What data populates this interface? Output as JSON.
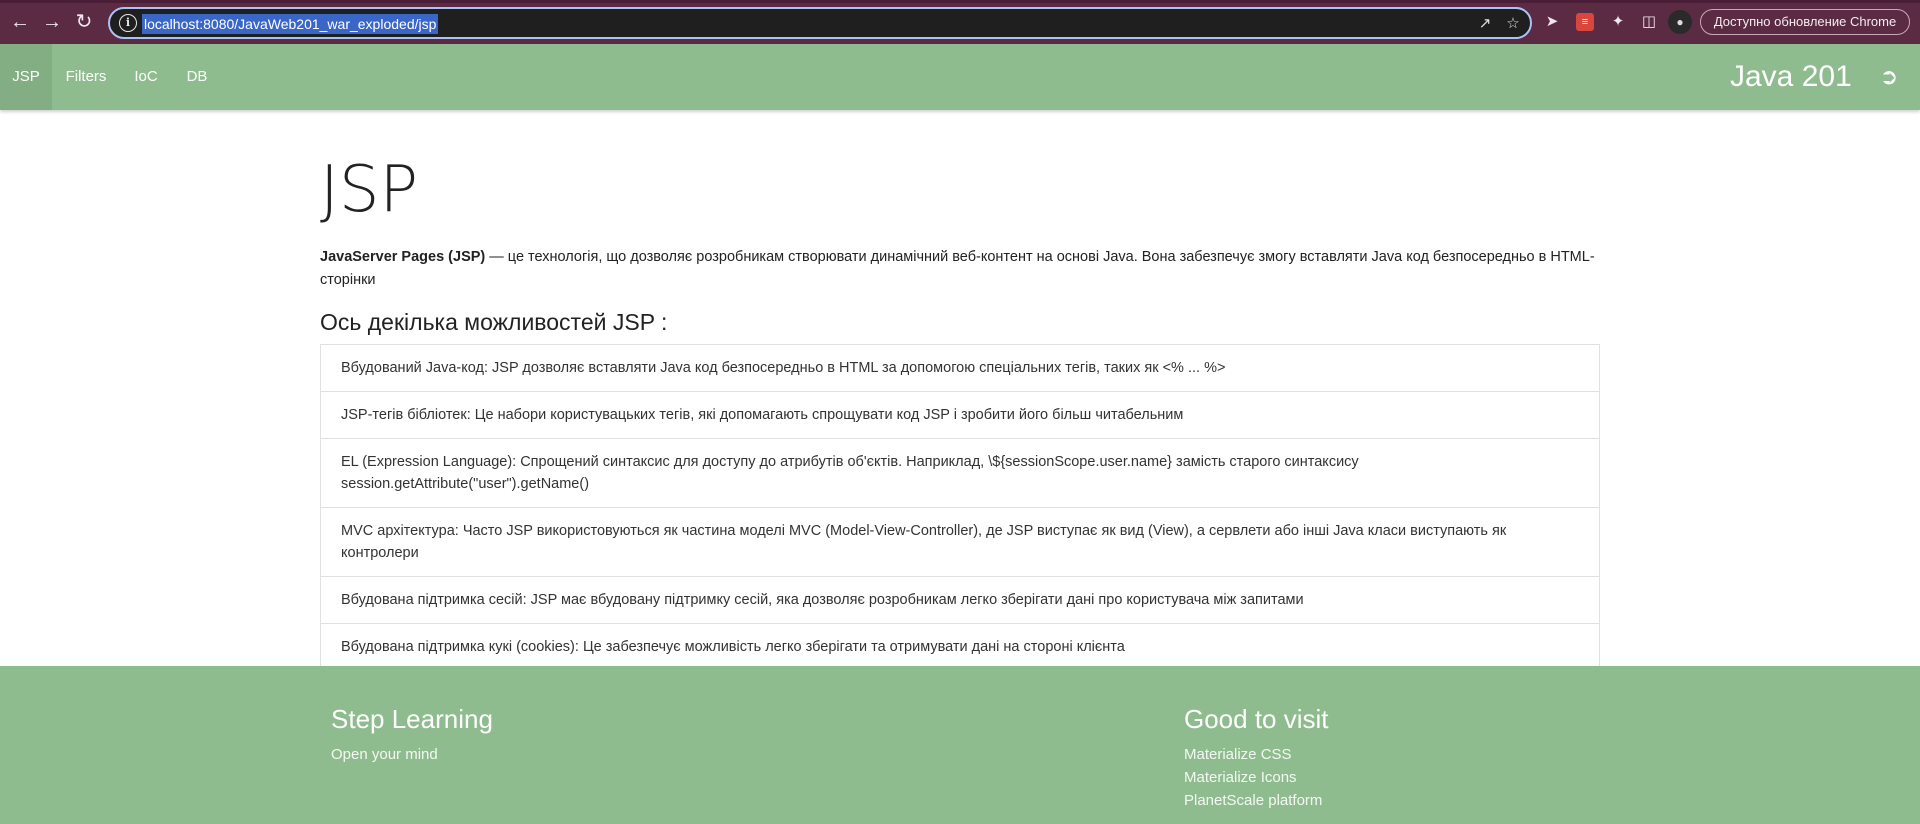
{
  "browser": {
    "url": "localhost:8080/JavaWeb201_war_exploded/jsp",
    "update_label": "Доступно обновление Chrome"
  },
  "nav": {
    "tabs": [
      {
        "label": "JSP",
        "active": true
      },
      {
        "label": "Filters",
        "active": false
      },
      {
        "label": "IoC",
        "active": false
      },
      {
        "label": "DB",
        "active": false
      }
    ],
    "brand": "Java 201"
  },
  "main": {
    "title": "JSP",
    "intro_bold": "JavaServer Pages (JSP)",
    "intro_rest": " — це технологія, що дозволяє розробникам створювати динамічний веб-контент на основі Java. Вона забезпечує змогу вставляти Java код безпосередньо в HTML-сторінки",
    "section_title": "Ось декілька можливостей JSP :",
    "features": [
      "Вбудований Java-код: JSP дозволяє вставляти Java код безпосередньо в HTML за допомогою спеціальних тегів, таких як <% ... %>",
      "JSP-тегів бібліотек: Це набори користувацьких тегів, які допомагають спрощувати код JSP і зробити його більш читабельним",
      "EL (Expression Language): Спрощений синтаксис для доступу до атрибутів об'єктів. Наприклад, \\${sessionScope.user.name} замість старого синтаксису session.getAttribute(\"user\").getName()",
      "MVC архітектура: Часто JSP використовуються як частина моделі MVC (Model-View-Controller), де JSP виступає як вид (View), а сервлети або інші Java класи виступають як контролери",
      "Вбудована підтримка сесій: JSP має вбудовану підтримку сесій, яка дозволяє розробникам легко зберігати дані про користувача між запитами",
      "Вбудована підтримка кукі (cookies): Це забезпечує можливість легко зберігати та отримувати дані на стороні клієнта"
    ]
  },
  "footer": {
    "left_title": "Step Learning",
    "left_text": "Open your mind",
    "right_title": "Good to visit",
    "links": [
      "Materialize CSS",
      "Materialize Icons",
      "PlanetScale platform"
    ]
  },
  "colors": {
    "nav_bg": "#8fbc8f",
    "chrome_bg": "#5b2b44"
  }
}
